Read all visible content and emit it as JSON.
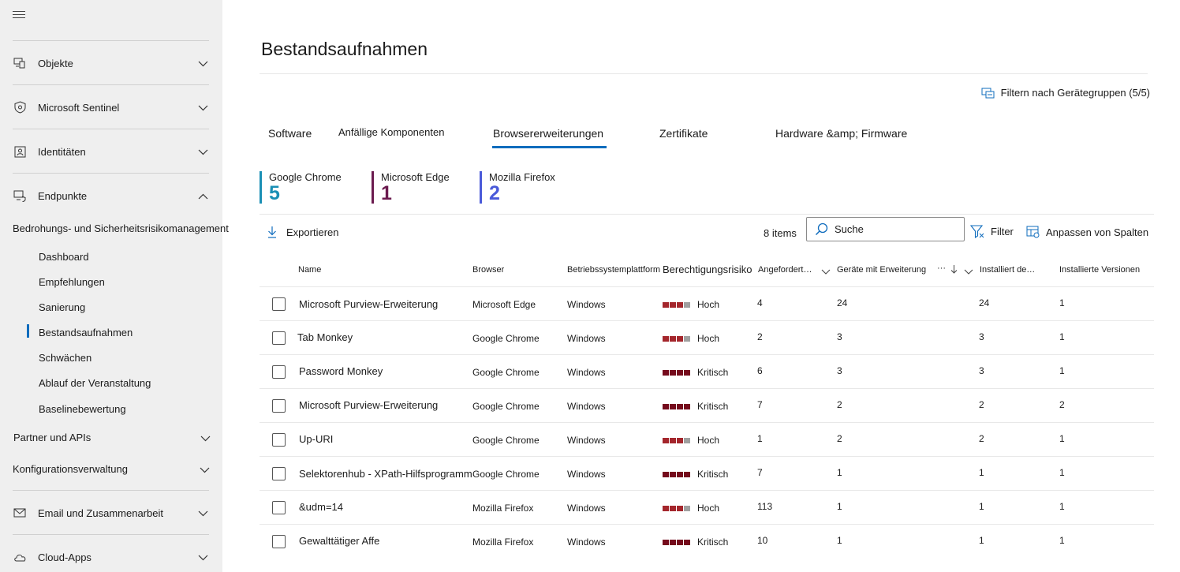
{
  "sidebar": {
    "sections": [
      {
        "label": "Objekte",
        "icon": "devices-icon"
      },
      {
        "label": "Microsoft Sentinel",
        "icon": "shield-icon"
      },
      {
        "label": "Identitäten",
        "icon": "identity-card-icon"
      },
      {
        "label": "Endpunkte",
        "icon": "endpoint-icon"
      }
    ],
    "group_title": "Bedrohungs- und Sicherheitsrisikomanagement",
    "sub_items": [
      "Dashboard",
      "Empfehlungen",
      "Sanierung",
      "Bestandsaufnahmen",
      "Schwächen",
      "Ablauf der Veranstaltung",
      "Baselinebewertung"
    ],
    "partner": "Partner und APIs",
    "config": "Konfigurationsverwaltung",
    "email": "Email und Zusammenarbeit",
    "cloud": "Cloud-Apps"
  },
  "page": {
    "title": "Bestandsaufnahmen",
    "filter_groups": "Filtern nach Gerätegruppen (5/5)"
  },
  "tabs": [
    "Software",
    "Anfällige Komponenten",
    "Browsererweiterungen",
    "Zertifikate",
    "Hardware &amp; Firmware"
  ],
  "kpis": [
    {
      "label": "Google Chrome",
      "value": "5",
      "color": "#1a8fb5"
    },
    {
      "label": "Microsoft Edge",
      "value": "1",
      "color": "#6b1b4f"
    },
    {
      "label": "Mozilla Firefox",
      "value": "2",
      "color": "#4a5ad9"
    }
  ],
  "toolbar": {
    "export": "Exportieren",
    "items_count": "8 items",
    "search_placeholder": "Suche",
    "filter": "Filter",
    "customize_columns": "Anpassen von Spalten"
  },
  "table": {
    "headers": {
      "name": "Name",
      "browser": "Browser",
      "os": "Betriebssystemplattform",
      "risk": "Berechtigungsrisiko",
      "requested": "Angefordert…",
      "devices": "Geräte mit Erweiterung",
      "installed_on": "Installiert de…",
      "versions": "Installierte Versionen"
    },
    "rows": [
      {
        "name": "Microsoft Purview-Erweiterung",
        "browser": "Microsoft Edge",
        "os": "Windows",
        "risk": "Hoch",
        "risk_level": 3,
        "requested": "4",
        "devices": "24",
        "installed": "24",
        "versions": "1"
      },
      {
        "name": "Tab Monkey",
        "browser": "Google Chrome",
        "os": "Windows",
        "risk": "Hoch",
        "risk_level": 3,
        "requested": "2",
        "devices": "3",
        "installed": "3",
        "versions": "1"
      },
      {
        "name": "Password Monkey",
        "browser": "Google Chrome",
        "os": "Windows",
        "risk": "Kritisch",
        "risk_level": 4,
        "requested": "6",
        "devices": "3",
        "installed": "3",
        "versions": "1"
      },
      {
        "name": "Microsoft Purview-Erweiterung",
        "browser": "Google Chrome",
        "os": "Windows",
        "risk": "Kritisch",
        "risk_level": 4,
        "requested": "7",
        "devices": "2",
        "installed": "2",
        "versions": "2"
      },
      {
        "name": "Up-URI",
        "browser": "Google Chrome",
        "os": "Windows",
        "risk": "Hoch",
        "risk_level": 3,
        "requested": "1",
        "devices": "2",
        "installed": "2",
        "versions": "1"
      },
      {
        "name": "Selektorenhub - XPath-Hilfsprogramm",
        "browser": "Google Chrome",
        "os": "Windows",
        "risk": "Kritisch",
        "risk_level": 4,
        "requested": "7",
        "devices": "1",
        "installed": "1",
        "versions": "1"
      },
      {
        "name": "&udm=14",
        "browser": "Mozilla Firefox",
        "os": "Windows",
        "risk": "Hoch",
        "risk_level": 3,
        "requested": "113",
        "devices": "1",
        "installed": "1",
        "versions": "1"
      },
      {
        "name": "Gewalttätiger Affe",
        "browser": "Mozilla Firefox",
        "os": "Windows",
        "risk": "Kritisch",
        "risk_level": 4,
        "requested": "10",
        "devices": "1",
        "installed": "1",
        "versions": "1"
      }
    ]
  },
  "colors": {
    "accent": "#0f6cbd",
    "risk_high": "#a4262c",
    "risk_critical": "#750b1c",
    "risk_empty": "#a0a0a0"
  }
}
